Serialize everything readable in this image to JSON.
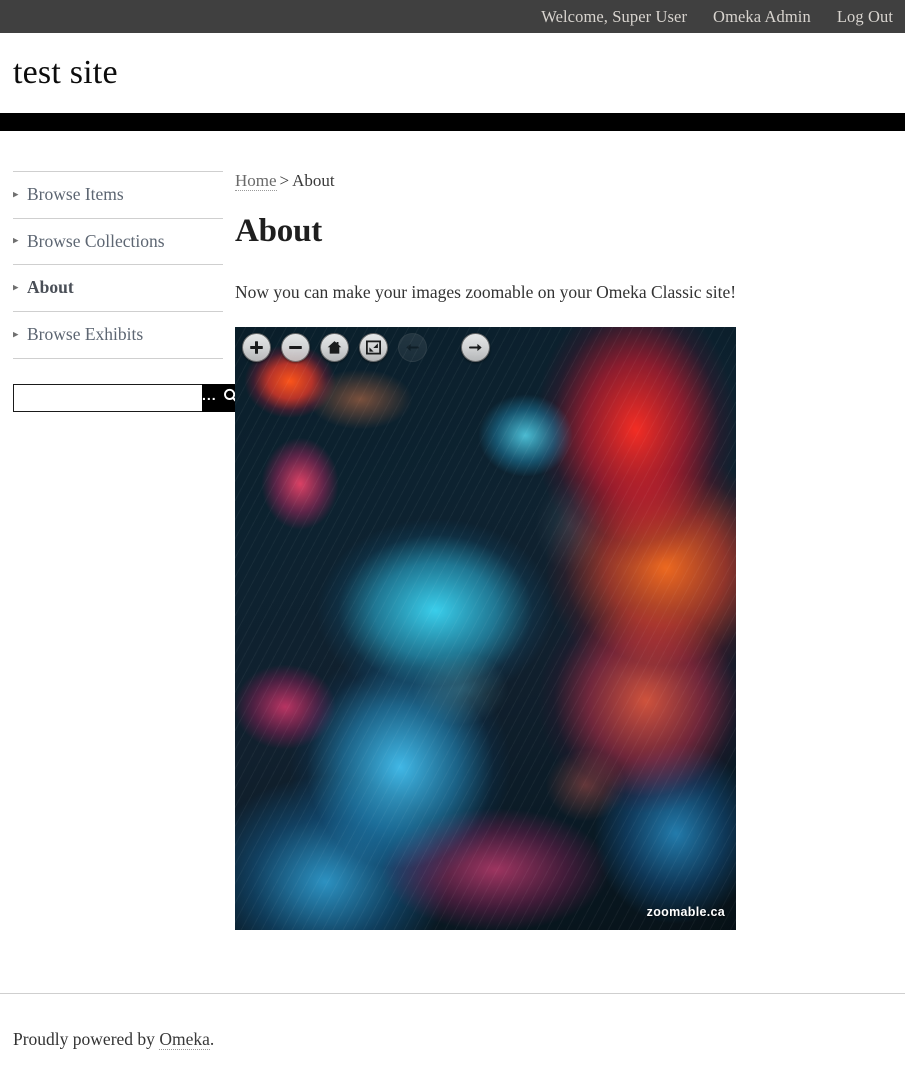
{
  "admin_bar": {
    "links": [
      {
        "name": "welcome-user",
        "label": "Welcome, Super User"
      },
      {
        "name": "omeka-admin",
        "label": "Omeka Admin"
      },
      {
        "name": "log-out",
        "label": "Log Out"
      }
    ]
  },
  "header": {
    "site_title": "test site"
  },
  "sidebar": {
    "items": [
      {
        "label": "Browse Items",
        "active": false
      },
      {
        "label": "Browse Collections",
        "active": false
      },
      {
        "label": "About",
        "active": true
      },
      {
        "label": "Browse Exhibits",
        "active": false
      }
    ],
    "search": {
      "value": "",
      "placeholder": "",
      "advanced_label": "...",
      "submit_label": "Search"
    }
  },
  "main": {
    "breadcrumb": {
      "home_label": "Home",
      "separator": ">",
      "current_label": "About"
    },
    "page_title": "About",
    "body_text": "Now you can make your images zoomable on your Omeka Classic site!",
    "viewer": {
      "controls": [
        {
          "name": "zoom-in-button",
          "icon": "plus-icon",
          "title": "Zoom in",
          "faded": false
        },
        {
          "name": "zoom-out-button",
          "icon": "minus-icon",
          "title": "Zoom out",
          "faded": false
        },
        {
          "name": "home-button",
          "icon": "home-icon",
          "title": "Go home",
          "faded": false
        },
        {
          "name": "full-page-button",
          "icon": "expand-icon",
          "title": "Toggle full page",
          "faded": false
        },
        {
          "name": "previous-button",
          "icon": "arrow-left-icon",
          "title": "Previous page",
          "faded": true
        },
        {
          "name": "next-button",
          "icon": "arrow-right-icon",
          "title": "Next page",
          "faded": false
        }
      ],
      "watermark": "zoomable.ca"
    }
  },
  "footer": {
    "prefix": "Proudly powered by ",
    "link_label": "Omeka",
    "suffix": "."
  },
  "colors": {
    "admin_bar": "#404040",
    "nav_bar": "#000000",
    "text": "#333333",
    "muted_link": "#5d6672",
    "rule": "#cfcfcf"
  }
}
